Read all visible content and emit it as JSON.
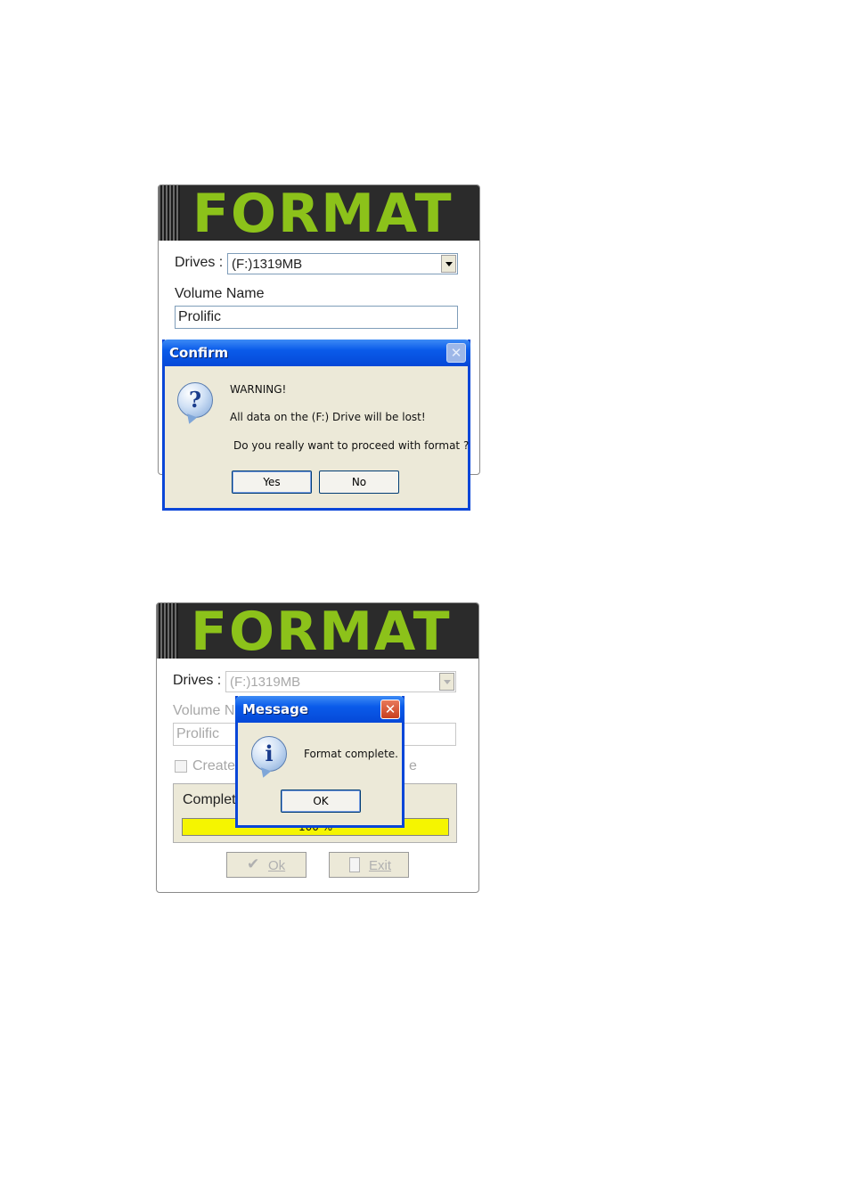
{
  "screen1": {
    "banner_title": "FORMAT",
    "drives_label": "Drives :",
    "drive_value": "(F:)1319MB",
    "volume_label": "Volume Name",
    "volume_value": "Prolific",
    "confirm_dialog": {
      "title": "Confirm",
      "close_glyph": "✕",
      "warning": "WARNING!",
      "line1": "All data on the (F:) Drive will be lost!",
      "line2": "Do you really want to proceed with format ?",
      "yes_label": "Yes",
      "no_label": "No",
      "icon": "question-icon",
      "icon_glyph": "?"
    }
  },
  "screen2": {
    "banner_title": "FORMAT",
    "drives_label": "Drives :",
    "drive_value": "(F:)1319MB",
    "volume_label": "Volume N",
    "volume_value": "Prolific",
    "checkbox_label": "Create",
    "checkbox_trailing": "e",
    "complete_label": "Complet",
    "progress_text": "100 %",
    "progress_fraction": 1.0,
    "ok_label": "Ok",
    "exit_label": "Exit",
    "message_dialog": {
      "title": "Message",
      "close_glyph": "✕",
      "text": "Format complete.",
      "ok_label": "OK",
      "icon": "info-icon",
      "icon_glyph": "i"
    }
  }
}
